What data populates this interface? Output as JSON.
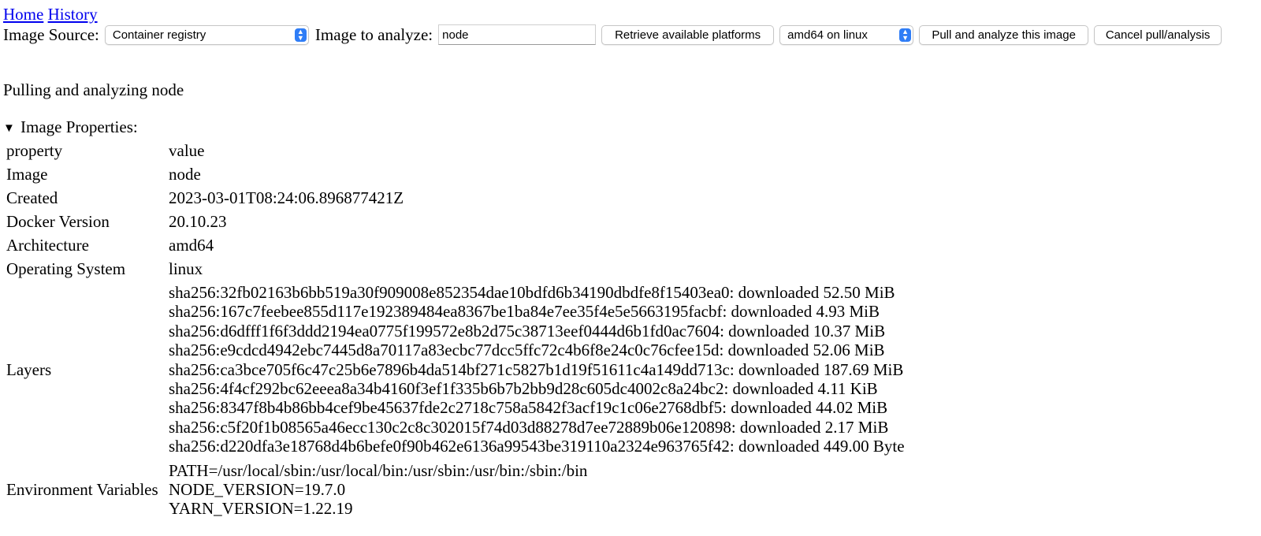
{
  "nav": {
    "home": "Home",
    "history": "History"
  },
  "toolbar": {
    "source_label": "Image Source:",
    "source_value": "Container registry",
    "image_label": "Image to analyze:",
    "image_value": "node",
    "retrieve_button": "Retrieve available platforms",
    "platform_value": "amd64 on linux",
    "pull_button": "Pull and analyze this image",
    "cancel_button": "Cancel pull/analysis"
  },
  "status": "Pulling and analyzing node",
  "properties": {
    "summary": "Image Properties:",
    "header": {
      "property": "property",
      "value": "value"
    },
    "image": {
      "key": "Image",
      "value": "node"
    },
    "created": {
      "key": "Created",
      "value": "2023-03-01T08:24:06.896877421Z"
    },
    "docker_version": {
      "key": "Docker Version",
      "value": "20.10.23"
    },
    "architecture": {
      "key": "Architecture",
      "value": "amd64"
    },
    "os": {
      "key": "Operating System",
      "value": "linux"
    },
    "layers": {
      "key": "Layers",
      "items": [
        "sha256:32fb02163b6bb519a30f909008e852354dae10bdfd6b34190dbdfe8f15403ea0: downloaded 52.50 MiB",
        "sha256:167c7feebee855d117e192389484ea8367be1ba84e7ee35f4e5e5663195facbf: downloaded 4.93 MiB",
        "sha256:d6dfff1f6f3ddd2194ea0775f199572e8b2d75c38713eef0444d6b1fd0ac7604: downloaded 10.37 MiB",
        "sha256:e9cdcd4942ebc7445d8a70117a83ecbc77dcc5ffc72c4b6f8e24c0c76cfee15d: downloaded 52.06 MiB",
        "sha256:ca3bce705f6c47c25b6e7896b4da514bf271c5827b1d19f51611c4a149dd713c: downloaded 187.69 MiB",
        "sha256:4f4cf292bc62eeea8a34b4160f3ef1f335b6b7b2bb9d28c605dc4002c8a24bc2: downloaded 4.11 KiB",
        "sha256:8347f8b4b86bb4cef9be45637fde2c2718c758a5842f3acf19c1c06e2768dbf5: downloaded 44.02 MiB",
        "sha256:c5f20f1b08565a46ecc130c2c8c302015f74d03d88278d7ee72889b06e120898: downloaded 2.17 MiB",
        "sha256:d220dfa3e18768d4b6befe0f90b462e6136a99543be319110a2324e963765f42: downloaded 449.00 Byte"
      ]
    },
    "env": {
      "key": "Environment Variables",
      "items": [
        "PATH=/usr/local/sbin:/usr/local/bin:/usr/sbin:/usr/bin:/sbin:/bin",
        "NODE_VERSION=19.7.0",
        "YARN_VERSION=1.22.19"
      ]
    }
  }
}
